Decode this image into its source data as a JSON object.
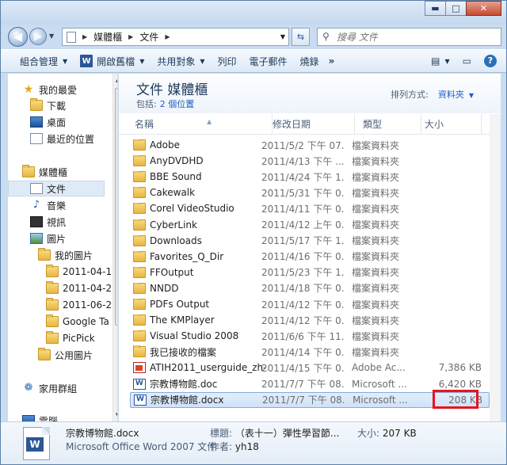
{
  "window": {
    "buttons": {
      "minimize": "▬",
      "maximize": "□",
      "close": "✕"
    }
  },
  "address": {
    "breadcrumb": [
      "媒體櫃",
      "文件"
    ],
    "refresh_icon": "refresh-icon"
  },
  "search": {
    "placeholder": "搜尋 文件"
  },
  "toolbar": {
    "organize": "組合管理",
    "open": "開啟舊檔",
    "share": "共用對象",
    "print": "列印",
    "email": "電子郵件",
    "burn": "燒錄",
    "more": "»"
  },
  "nav": {
    "favorites": "我的最愛",
    "downloads": "下載",
    "desktop": "桌面",
    "recent": "最近的位置",
    "libraries": "媒體櫃",
    "documents": "文件",
    "music": "音樂",
    "videos": "視訊",
    "pictures": "圖片",
    "my_pictures": "我的圖片",
    "pic_sub": [
      "2011-04-1",
      "2011-04-2",
      "2011-06-2",
      "Google Ta",
      "PicPick"
    ],
    "public_pictures": "公用圖片",
    "homegroup": "家用群組",
    "computer": "電腦"
  },
  "library": {
    "title": "文件 媒體櫃",
    "includes_label": "包括:",
    "includes_link": "2 個位置",
    "arrange_label": "排列方式:",
    "arrange_value": "資料夾"
  },
  "columns": {
    "name": "名稱",
    "date": "修改日期",
    "type": "類型",
    "size": "大小"
  },
  "files": [
    {
      "name": "Adobe",
      "date": "2011/5/2 下午 07...",
      "type": "檔案資料夾",
      "size": "",
      "icon": "folder"
    },
    {
      "name": "AnyDVDHD",
      "date": "2011/4/13 下午 ...",
      "type": "檔案資料夾",
      "size": "",
      "icon": "folder"
    },
    {
      "name": "BBE Sound",
      "date": "2011/4/24 下午 1...",
      "type": "檔案資料夾",
      "size": "",
      "icon": "folder"
    },
    {
      "name": "Cakewalk",
      "date": "2011/5/31 下午 0...",
      "type": "檔案資料夾",
      "size": "",
      "icon": "folder"
    },
    {
      "name": "Corel VideoStudio",
      "date": "2011/4/11 下午 0...",
      "type": "檔案資料夾",
      "size": "",
      "icon": "folder"
    },
    {
      "name": "CyberLink",
      "date": "2011/4/12 上午 0...",
      "type": "檔案資料夾",
      "size": "",
      "icon": "folder"
    },
    {
      "name": "Downloads",
      "date": "2011/5/17 下午 1...",
      "type": "檔案資料夾",
      "size": "",
      "icon": "folder"
    },
    {
      "name": "Favorites_Q_Dir",
      "date": "2011/4/16 下午 0...",
      "type": "檔案資料夾",
      "size": "",
      "icon": "folder"
    },
    {
      "name": "FFOutput",
      "date": "2011/5/23 下午 1...",
      "type": "檔案資料夾",
      "size": "",
      "icon": "folder"
    },
    {
      "name": "NNDD",
      "date": "2011/4/18 下午 0...",
      "type": "檔案資料夾",
      "size": "",
      "icon": "folder"
    },
    {
      "name": "PDFs Output",
      "date": "2011/4/12 下午 0...",
      "type": "檔案資料夾",
      "size": "",
      "icon": "folder"
    },
    {
      "name": "The KMPlayer",
      "date": "2011/4/12 下午 0...",
      "type": "檔案資料夾",
      "size": "",
      "icon": "folder"
    },
    {
      "name": "Visual Studio 2008",
      "date": "2011/6/6 下午 11...",
      "type": "檔案資料夾",
      "size": "",
      "icon": "folder"
    },
    {
      "name": "我已接收的檔案",
      "date": "2011/4/14 下午 0...",
      "type": "檔案資料夾",
      "size": "",
      "icon": "folder"
    },
    {
      "name": "ATIH2011_userguide_zh-...",
      "date": "2011/4/15 下午 0...",
      "type": "Adobe Ac...",
      "size": "7,386 KB",
      "icon": "pdf"
    },
    {
      "name": "宗教博物館.doc",
      "date": "2011/7/7 下午 08...",
      "type": "Microsoft ...",
      "size": "6,420 KB",
      "icon": "word"
    },
    {
      "name": "宗教博物館.docx",
      "date": "2011/7/7 下午 08...",
      "type": "Microsoft ...",
      "size": "208 KB",
      "icon": "word"
    }
  ],
  "details": {
    "name": "宗教博物館.docx",
    "type": "Microsoft Office Word 2007 文件",
    "title_label": "標題:",
    "title_value": "（表十一）彈性學習節...",
    "author_label": "作者:",
    "author_value": "yh18",
    "size_label": "大小:",
    "size_value": "207 KB"
  }
}
